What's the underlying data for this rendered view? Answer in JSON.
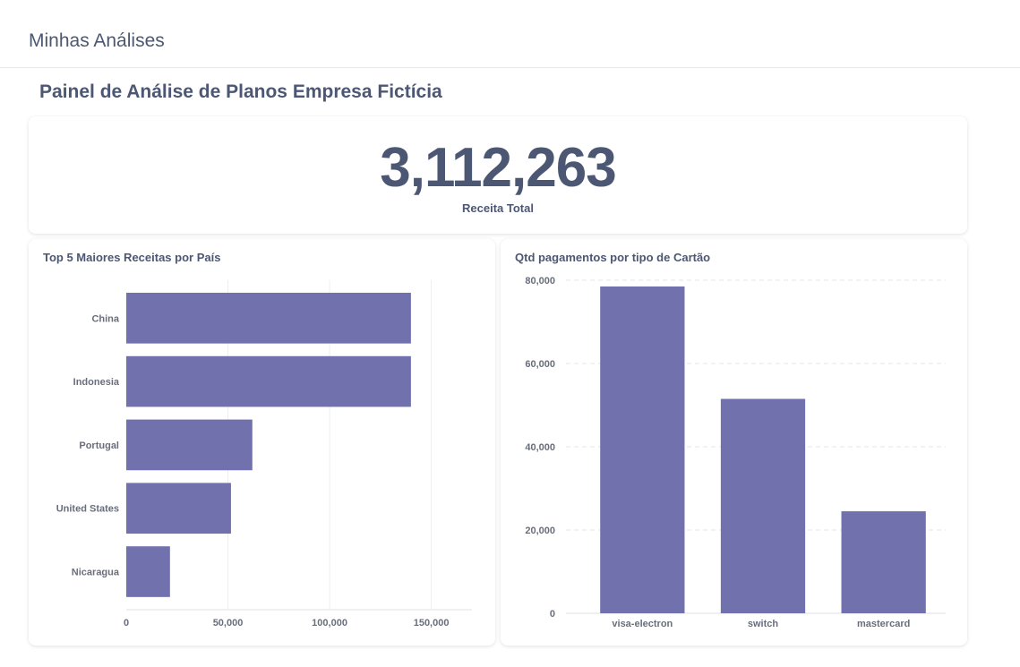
{
  "app": {
    "title": "Minhas Análises"
  },
  "dashboard": {
    "title": "Painel de Análise de Planos Empresa Fictícia"
  },
  "kpi": {
    "value": "3,112,263",
    "label": "Receita Total"
  },
  "colors": {
    "bar": "#7172ad",
    "text": "#4c5773",
    "tick": "#696e7b"
  },
  "chart_data": [
    {
      "type": "bar",
      "orientation": "horizontal",
      "title": "Top 5 Maiores Receitas por País",
      "categories": [
        "China",
        "Indonesia",
        "Portugal",
        "United States",
        "Nicaragua"
      ],
      "values": [
        140000,
        140000,
        62000,
        51500,
        21500
      ],
      "xlim": [
        0,
        170000
      ],
      "x_ticks": [
        0,
        50000,
        100000,
        150000
      ],
      "x_tick_labels": [
        "0",
        "50,000",
        "100,000",
        "150,000"
      ],
      "grid": true
    },
    {
      "type": "bar",
      "orientation": "vertical",
      "title": "Qtd pagamentos por tipo de Cartão",
      "categories": [
        "visa-electron",
        "switch",
        "mastercard"
      ],
      "values": [
        78500,
        51500,
        24500
      ],
      "ylim": [
        0,
        80000
      ],
      "y_ticks": [
        0,
        20000,
        40000,
        60000,
        80000
      ],
      "y_tick_labels": [
        "0",
        "20,000",
        "40,000",
        "60,000",
        "80,000"
      ],
      "grid": true
    }
  ]
}
